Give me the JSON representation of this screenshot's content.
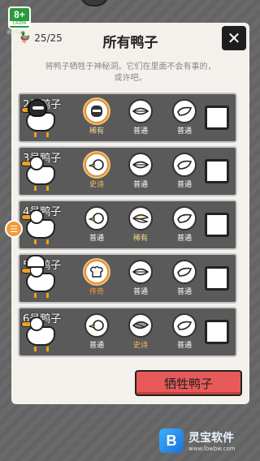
{
  "age_badge": {
    "rating": "8+",
    "label": "CADPA",
    "caption": "适龄提示"
  },
  "header": {
    "count": "25/25",
    "count_icon": "duck-icon",
    "title": "所有鸭子",
    "close_label": "✕"
  },
  "description": {
    "line1": "将鸭子牺牲于神秘洞。它们在里面不会有事的，",
    "line2": "或许吧。"
  },
  "rows": [
    {
      "name": "2号鸭子",
      "hat": "ninja",
      "slots": [
        {
          "label": "稀有",
          "tier": "rare",
          "icon": "ninja-hat-icon"
        },
        {
          "label": "普通",
          "tier": "common",
          "icon": "mouth-icon"
        },
        {
          "label": "普通",
          "tier": "common",
          "icon": "wing-icon"
        }
      ]
    },
    {
      "name": "3号鸭子",
      "hat": "none",
      "slots": [
        {
          "label": "史诗",
          "tier": "epic",
          "icon": "duck-head-icon"
        },
        {
          "label": "普通",
          "tier": "common",
          "icon": "mouth-icon"
        },
        {
          "label": "普通",
          "tier": "common",
          "icon": "wing-icon"
        }
      ]
    },
    {
      "name": "4号鸭子",
      "hat": "none",
      "slots": [
        {
          "label": "普通",
          "tier": "common",
          "icon": "duck-head-icon"
        },
        {
          "label": "稀有",
          "tier": "rare",
          "icon": "beak-icon"
        },
        {
          "label": "普通",
          "tier": "common",
          "icon": "wing-icon"
        }
      ]
    },
    {
      "name": "5号鸭子",
      "hat": "chef",
      "slots": [
        {
          "label": "传奇",
          "tier": "legend",
          "icon": "chef-hat-icon"
        },
        {
          "label": "普通",
          "tier": "common",
          "icon": "mouth-icon"
        },
        {
          "label": "普通",
          "tier": "common",
          "icon": "wing-icon"
        }
      ]
    },
    {
      "name": "6号鸭子",
      "hat": "none",
      "slots": [
        {
          "label": "普通",
          "tier": "common",
          "icon": "duck-head-icon"
        },
        {
          "label": "史诗",
          "tier": "epic",
          "icon": "gray-beak-icon"
        },
        {
          "label": "普通",
          "tier": "common",
          "icon": "wing-icon"
        }
      ]
    }
  ],
  "sacrifice_button": "牺牲鸭子",
  "side_button_icon": "list-icon",
  "watermark": {
    "name": "灵宝软件",
    "url": "www.lbwbw.com",
    "logo": "B"
  },
  "colors": {
    "panel": "#f4f1ec",
    "row": "#5a5a5a",
    "accent_red": "#e85a5a",
    "rare": "#f3dc8c",
    "epic": "#f3c060",
    "legend": "#f19a4a"
  }
}
